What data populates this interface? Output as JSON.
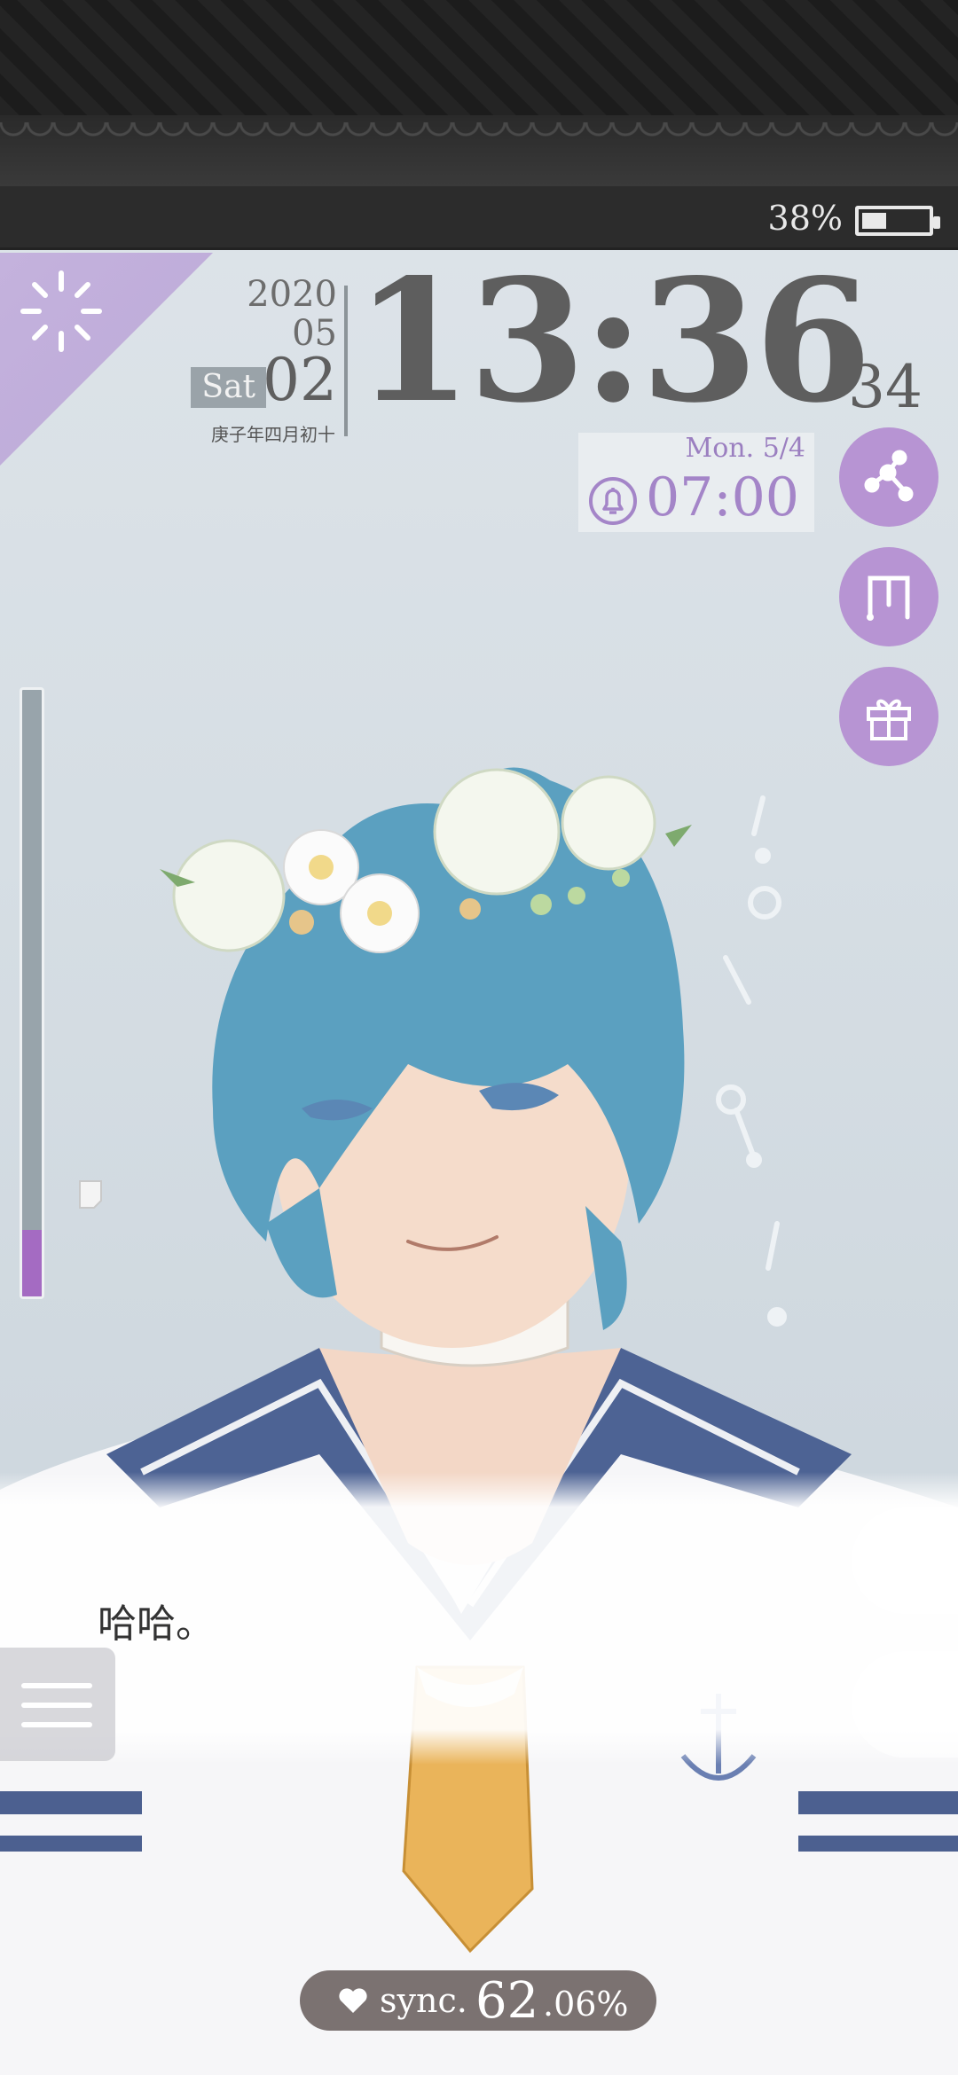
{
  "status": {
    "battery_text": "38%",
    "battery_level": 0.38
  },
  "date": {
    "year": "2020",
    "month": "05",
    "day": "02",
    "weekday": "Sat",
    "lunar": "庚子年四月初十"
  },
  "clock": {
    "hours_minutes": "13:36",
    "seconds": "34"
  },
  "alarm": {
    "date": "Mon. 5/4",
    "time": "07:00"
  },
  "side_buttons": [
    "share-icon",
    "bookmark-icon",
    "gift-icon"
  ],
  "gauge": {
    "level": 0.11
  },
  "dialog": {
    "text": "哈哈。"
  },
  "sync": {
    "label": "sync.",
    "int_part": "62",
    "dec_part": ".06%"
  },
  "colors": {
    "accent": "#b794d3",
    "corner": "#c4b2dd",
    "gauge_fill": "#a46bc2",
    "hair": "#5ba0c0",
    "sync_pill": "#7b7271"
  }
}
